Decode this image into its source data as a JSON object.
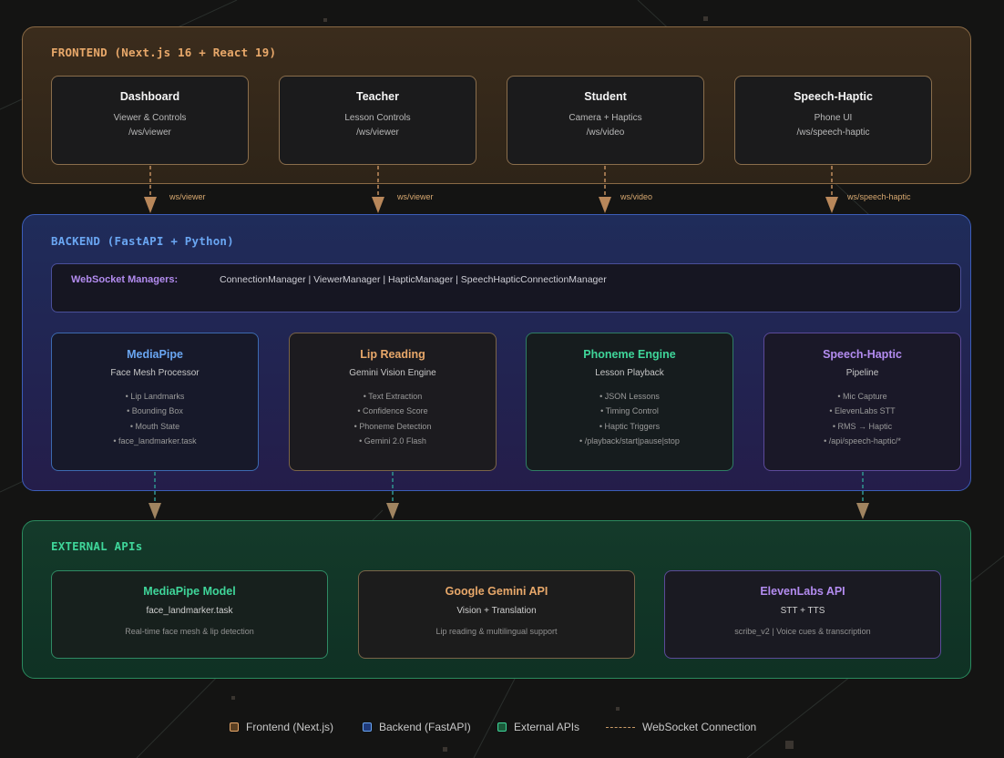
{
  "colors": {
    "frontend": "#e8a86a",
    "backend": "#6aa6f2",
    "external": "#3fd69a",
    "purple": "#b38cf0",
    "connection": "#c89a66"
  },
  "frontend": {
    "title": "FRONTEND (Next.js 16 + React 19)",
    "boxes": [
      {
        "title": "Dashboard",
        "line1": "Viewer & Controls",
        "line2": "/ws/viewer"
      },
      {
        "title": "Teacher",
        "line1": "Lesson Controls",
        "line2": "/ws/viewer"
      },
      {
        "title": "Student",
        "line1": "Camera + Haptics",
        "line2": "/ws/video"
      },
      {
        "title": "Speech-Haptic",
        "line1": "Phone UI",
        "line2": "/ws/speech-haptic"
      }
    ]
  },
  "connections": [
    "ws/viewer",
    "ws/viewer",
    "ws/video",
    "ws/speech-haptic"
  ],
  "backend": {
    "title": "BACKEND (FastAPI + Python)",
    "ws_label": "WebSocket Managers:",
    "ws_list": "ConnectionManager | ViewerManager | HapticManager | SpeechHapticConnectionManager",
    "boxes": [
      {
        "title": "MediaPipe",
        "subtitle": "Face Mesh Processor",
        "items": [
          "• Lip Landmarks",
          "• Bounding Box",
          "• Mouth State",
          "• face_landmarker.task"
        ]
      },
      {
        "title": "Lip Reading",
        "subtitle": "Gemini Vision Engine",
        "items": [
          "• Text Extraction",
          "• Confidence Score",
          "• Phoneme Detection",
          "• Gemini 2.0 Flash"
        ]
      },
      {
        "title": "Phoneme Engine",
        "subtitle": "Lesson Playback",
        "items": [
          "• JSON Lessons",
          "• Timing Control",
          "• Haptic Triggers",
          "• /playback/start|pause|stop"
        ]
      },
      {
        "title": "Speech-Haptic",
        "subtitle": "Pipeline",
        "items": [
          "• Mic Capture",
          "• ElevenLabs STT",
          "• RMS → Haptic",
          "• /api/speech-haptic/*"
        ]
      }
    ]
  },
  "external": {
    "title": "EXTERNAL APIs",
    "boxes": [
      {
        "title": "MediaPipe Model",
        "subtitle": "face_landmarker.task",
        "desc": "Real-time face mesh & lip detection"
      },
      {
        "title": "Google Gemini API",
        "subtitle": "Vision + Translation",
        "desc": "Lip reading & multilingual support"
      },
      {
        "title": "ElevenLabs API",
        "subtitle": "STT + TTS",
        "desc": "scribe_v2 | Voice cues & transcription"
      }
    ]
  },
  "legend": {
    "frontend": "Frontend (Next.js)",
    "backend": "Backend (FastAPI)",
    "external": "External APIs",
    "connection": "WebSocket Connection"
  }
}
